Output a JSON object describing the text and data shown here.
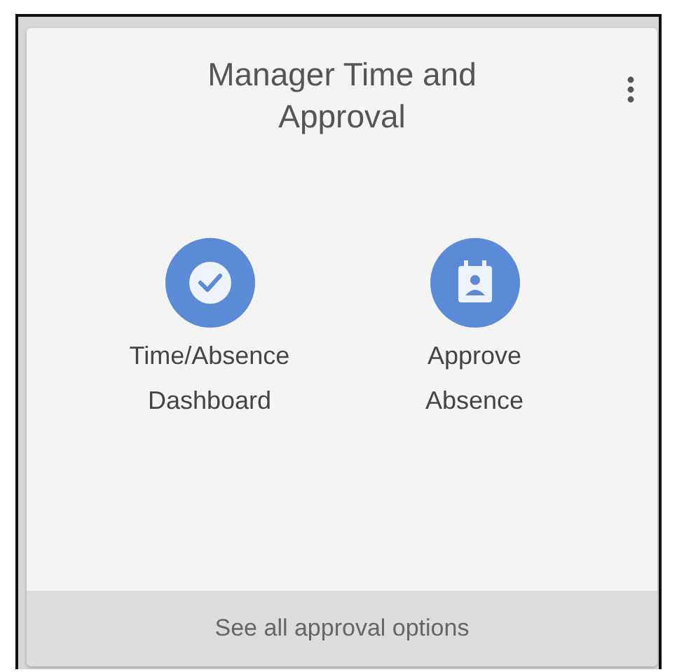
{
  "card": {
    "title": "Manager Time and Approval"
  },
  "tiles": [
    {
      "kind": "check",
      "label": "Time/Absence Dashboard"
    },
    {
      "kind": "calendar",
      "label": "Approve Absence"
    }
  ],
  "footer": {
    "link": "See all approval options"
  }
}
